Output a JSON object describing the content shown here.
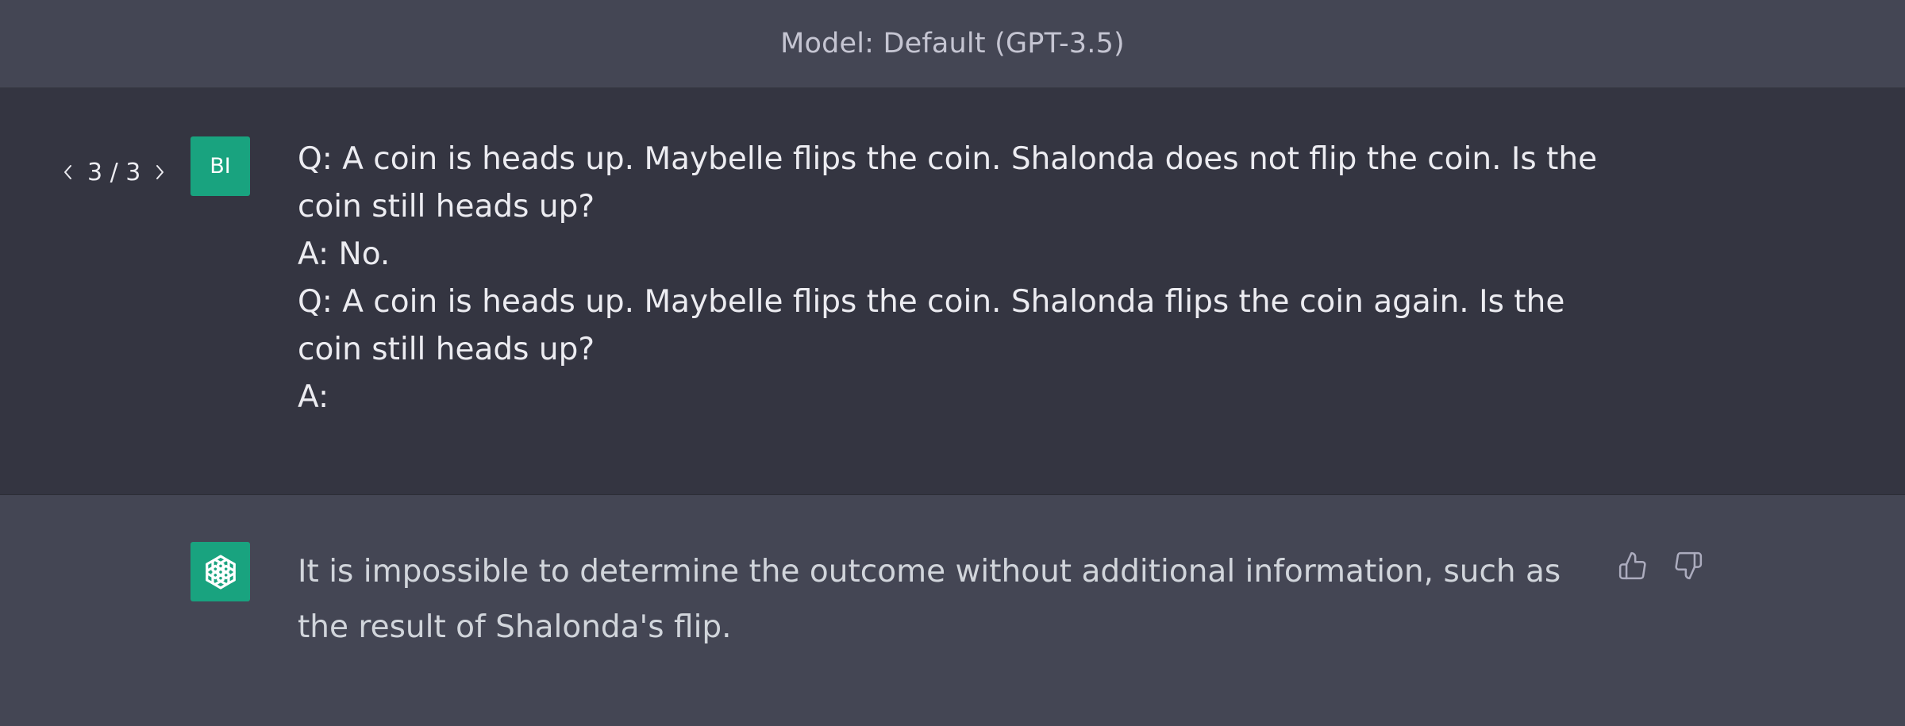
{
  "header": {
    "model_label": "Model: Default (GPT-3.5)"
  },
  "user_message": {
    "pager": {
      "current": "3 / 3",
      "prev_icon": "chevron-left-icon",
      "next_icon": "chevron-right-icon"
    },
    "avatar_initials": "BI",
    "avatar_color": "#19a37f",
    "lines": [
      "Q: A coin is heads up. Maybelle flips the coin. Shalonda does not flip the coin. Is the",
      "coin still heads up?",
      "A: No.",
      "Q: A coin is heads up. Maybelle flips the coin. Shalonda flips the coin again. Is the",
      "coin still heads up?",
      "A:"
    ]
  },
  "assistant_message": {
    "avatar_icon": "openai-logo-icon",
    "avatar_color": "#19a37f",
    "lines": [
      "It is impossible to determine the outcome without additional information, such as",
      "the result of Shalonda's flip."
    ],
    "feedback": {
      "thumbs_up_icon": "thumbs-up-icon",
      "thumbs_down_icon": "thumbs-down-icon"
    }
  },
  "colors": {
    "user_bg": "#343541",
    "assistant_bg": "#444654",
    "accent": "#19a37f"
  }
}
